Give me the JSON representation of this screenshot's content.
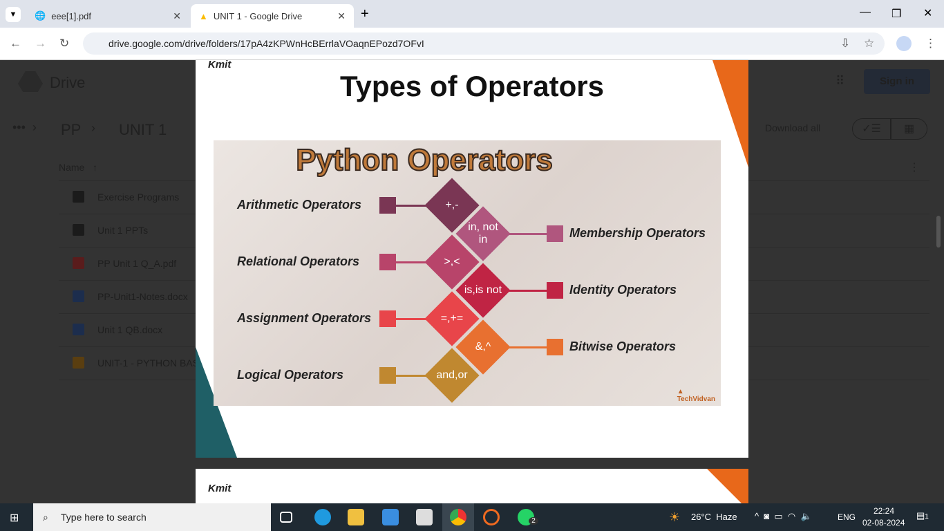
{
  "browser": {
    "tabs": [
      {
        "title": "eee[1].pdf"
      },
      {
        "title": "UNIT 1 - Google Drive"
      }
    ],
    "url": "drive.google.com/drive/folders/17pA4zKPWnHcBErrlaVOaqnEPozd7OFvI"
  },
  "drive": {
    "logo": "Drive",
    "sign_in": "Sign in",
    "breadcrumb": [
      "PP",
      "UNIT 1"
    ],
    "download_all": "Download all",
    "name_header": "Name",
    "files": [
      {
        "name": "Exercise Programs",
        "type": "folder",
        "color": "#1b1b1b"
      },
      {
        "name": "Unit 1 PPTs",
        "type": "folder",
        "color": "#1b1b1b"
      },
      {
        "name": "PP Unit 1 Q_A.pdf",
        "type": "pdf",
        "color": "#5a1c1c"
      },
      {
        "name": "PP-Unit1-Notes.docx",
        "type": "docx",
        "color": "#1c2d4d"
      },
      {
        "name": "Unit 1 QB.docx",
        "type": "docx",
        "color": "#1c2d4d"
      },
      {
        "name": "UNIT-1 - PYTHON BAS",
        "type": "pptx",
        "color": "#5a3e10"
      }
    ]
  },
  "slide": {
    "logo": "Kmit",
    "title": "Types of Operators",
    "image_title": "Python Operators",
    "watermark": "TechVidvan",
    "left": [
      {
        "label": "Arithmetic Operators",
        "symbol": "+,-",
        "color": "#7a3654"
      },
      {
        "label": "Relational Operators",
        "symbol": ">,<",
        "color": "#b8446a"
      },
      {
        "label": "Assignment Operators",
        "symbol": "=,+=",
        "color": "#e8454a"
      },
      {
        "label": "Logical Operators",
        "symbol": "and,or",
        "color": "#c08830"
      }
    ],
    "right": [
      {
        "label": "Membership Operators",
        "symbol": "in, not in",
        "color": "#b0567e"
      },
      {
        "label": "Identity Operators",
        "symbol": "is,is not",
        "color": "#c02444"
      },
      {
        "label": "Bitwise Operators",
        "symbol": "&,^",
        "color": "#e87030"
      }
    ]
  },
  "slide2": {
    "logo": "Kmit"
  },
  "taskbar": {
    "search": "Type here to search",
    "weather": "26°C  Haze",
    "lang": "ENG",
    "time": "22:24",
    "date": "02-08-2024",
    "whatsapp_badge": "2",
    "notif_badge": "1"
  }
}
